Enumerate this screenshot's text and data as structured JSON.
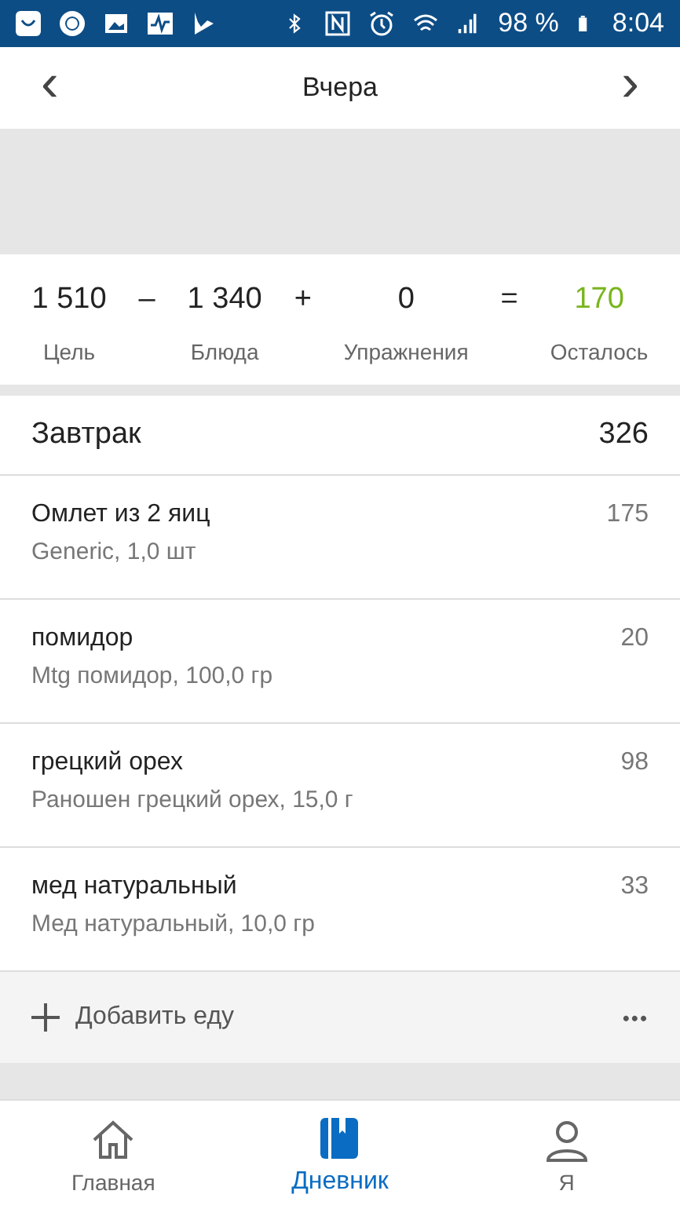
{
  "status_bar": {
    "battery": "98 %",
    "time": "8:04"
  },
  "header": {
    "title": "Вчера",
    "prev": "‹",
    "next": "›"
  },
  "summary": [
    {
      "kind": "value",
      "value": "1 510",
      "label": "Цель",
      "highlight": false
    },
    {
      "kind": "operator",
      "symbol": "–"
    },
    {
      "kind": "value",
      "value": "1 340",
      "label": "Блюда",
      "highlight": false
    },
    {
      "kind": "operator",
      "symbol": "+"
    },
    {
      "kind": "value",
      "value": "0",
      "label": "Упражнения",
      "highlight": false
    },
    {
      "kind": "operator",
      "symbol": "="
    },
    {
      "kind": "value",
      "value": "170",
      "label": "Осталось",
      "highlight": true
    }
  ],
  "meal": {
    "title": "Завтрак",
    "calories": "326",
    "items": [
      {
        "name": "Омлет из 2 яиц",
        "detail": "Generic, 1,0 шт",
        "calories": "175"
      },
      {
        "name": "помидор",
        "detail": "Mtg помидор, 100,0 гр",
        "calories": "20"
      },
      {
        "name": "грецкий орех",
        "detail": "Раношен грецкий орех, 15,0 г",
        "calories": "98"
      },
      {
        "name": "мед натуральный",
        "detail": "Мед натуральный, 10,0 гр",
        "calories": "33"
      }
    ],
    "add_label": "Добавить еду",
    "more": "•••"
  },
  "bottom_nav": [
    {
      "label": "Главная",
      "kind": "home",
      "selected": false
    },
    {
      "label": "Дневник",
      "kind": "diary",
      "selected": true
    },
    {
      "label": "Я",
      "kind": "person",
      "selected": false
    }
  ]
}
